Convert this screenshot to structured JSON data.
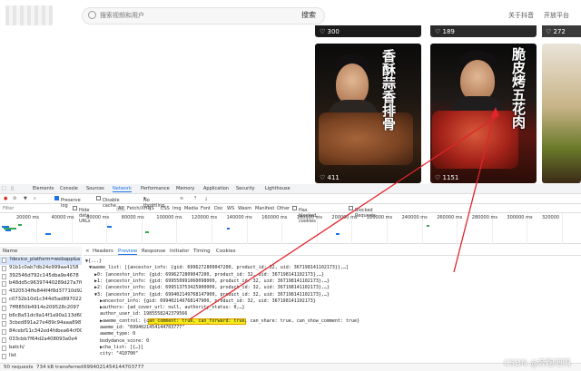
{
  "header": {
    "search_placeholder": "搜索视频和用户",
    "search_button": "搜索",
    "nav_about": "关于抖音",
    "nav_open": "开放平台"
  },
  "feed": {
    "top_counts": [
      "300",
      "189",
      "272"
    ],
    "cards": [
      {
        "title": "香酥蒜香排骨",
        "likes": "411"
      },
      {
        "title": "脆皮烤五花肉",
        "likes": "1151"
      }
    ]
  },
  "devtools": {
    "tabs": [
      "Elements",
      "Console",
      "Sources",
      "Network",
      "Performance",
      "Memory",
      "Application",
      "Security",
      "Lighthouse"
    ],
    "active_tab": "Network",
    "toolbar": {
      "preserve_log": "Preserve log",
      "disable_cache": "Disable cache",
      "throttle": "No throttling"
    },
    "filter": {
      "label": "Filter",
      "hide_data_urls": "Hide data URLs",
      "types": [
        "All",
        "Fetch/XHR",
        "JS",
        "CSS",
        "Img",
        "Media",
        "Font",
        "Doc",
        "WS",
        "Wasm",
        "Manifest",
        "Other"
      ],
      "has_blocked_cookies": "Has blocked cookies",
      "blocked_requests": "Blocked Requests"
    },
    "timeline_ticks": [
      "20000 ms",
      "40000 ms",
      "60000 ms",
      "80000 ms",
      "100000 ms",
      "120000 ms",
      "140000 ms",
      "160000 ms",
      "180000 ms",
      "200000 ms",
      "220000 ms",
      "240000 ms",
      "260000 ms",
      "280000 ms",
      "300000 ms",
      "320000"
    ],
    "list_header": "Name",
    "requests": [
      "?device_platform=webapp&a",
      "91b1c0ab7db24e999aa4158",
      "392546d792c145dba9e4678",
      "b48dd5c96397440289d27a7f6",
      "4320534ffe844f4f8d37710d92",
      "c0732b10d1c344d5ad897022",
      "7ff8850b4914e209528c2097",
      "b6c8a51dc9a14f1a90a113d60",
      "3cbed891a27e489c94aaa8987",
      "84cebf11c342ed4fdbea64cf00",
      "033cbb7f64d2a408093a0e4",
      "batch/",
      "list"
    ],
    "panel_tabs": [
      "Headers",
      "Preview",
      "Response",
      "Initiator",
      "Timing",
      "Cookies"
    ],
    "active_panel_tab": "Preview",
    "preview_lines": [
      "▼{...}",
      "▼aweme_list: [{ancestor_info: {gid: 6996272809047200, product_id: 32, uid: 367198141102173}},…]",
      "▶0: {ancestor_info: {gid: 6996272809047200, product_id: 32, uid: 367198141102173},…}",
      "▶1: {ancestor_info: {gid: 699550991060098000, product_id: 32, uid: 367198141102173},…}",
      "▶2: {ancestor_info: {gid: 699513753425900000, product_id: 32, uid: 367198141102173},…}",
      "▼3: {ancestor_info: {gid: 699402149768147900, product_id: 32, uid: 367198141102173},…}",
      "▶ancestor_info: {gid: 699402149768147900, product_id: 32, uid: 367198141102173}",
      "▶authors: {ad_cover_url: null, authority_status: 0,…}",
      "author_user_id: 1985558242379566",
      "▶aweme_control: {can_comment: true, can_forward: true, can_share: true, can_show_comment: true}",
      "aweme_id: \"6994021454144703777\"",
      "aweme_type: 0",
      "bodydance_score: 0",
      "▶cha_list: [{…}]",
      "city: \"410700\""
    ],
    "status": {
      "requests": "50 requests",
      "transferred": "734 kB transferred",
      "selected_id": "6994021454144703777"
    }
  },
  "watermark": "CSDN @奔跑吧鸭"
}
